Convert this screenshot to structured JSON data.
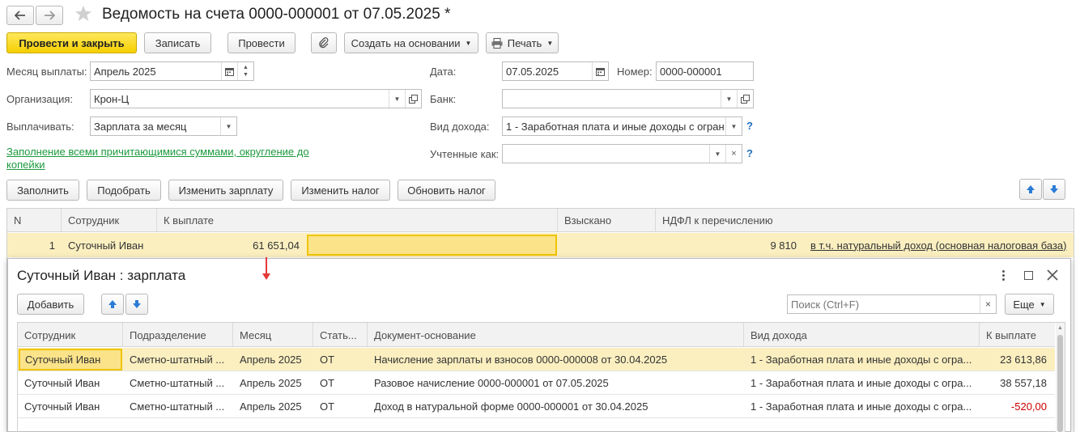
{
  "window": {
    "title": "Ведомость на счета 0000-000001 от 07.05.2025 *"
  },
  "toolbar": {
    "post_close": "Провести и закрыть",
    "save": "Записать",
    "post": "Провести",
    "create_based": "Создать на основании",
    "print": "Печать"
  },
  "form": {
    "month_label": "Месяц выплаты:",
    "month_value": "Апрель 2025",
    "org_label": "Организация:",
    "org_value": "Крон-Ц",
    "pay_label": "Выплачивать:",
    "pay_value": "Зарплата за месяц",
    "fill_link": "Заполнение всеми причитающимися суммами, округление до копейки",
    "date_label": "Дата:",
    "date_value": "07.05.2025",
    "number_label": "Номер:",
    "number_value": "0000-000001",
    "bank_label": "Банк:",
    "bank_value": "",
    "income_label": "Вид дохода:",
    "income_value": "1 - Заработная плата и иные доходы с огран",
    "accounted_label": "Учтенные как:",
    "accounted_value": "",
    "help": "?"
  },
  "actions": {
    "fill": "Заполнить",
    "pick": "Подобрать",
    "change_salary": "Изменить зарплату",
    "change_tax": "Изменить налог",
    "update_tax": "Обновить налог"
  },
  "main_table": {
    "headers": [
      "N",
      "Сотрудник",
      "К выплате",
      "Взыскано",
      "НДФЛ к перечислению"
    ],
    "rows": [
      {
        "n": "1",
        "employee": "Суточный Иван",
        "to_pay": "61 651,04",
        "collected": "",
        "ndfl": "9 810",
        "ndfl_link": "в т.ч. натуральный доход (основная налоговая база)"
      }
    ]
  },
  "popup": {
    "title": "Суточный Иван : зарплата",
    "add": "Добавить",
    "search_placeholder": "Поиск (Ctrl+F)",
    "more": "Еще",
    "headers": [
      "Сотрудник",
      "Подразделение",
      "Месяц",
      "Стать...",
      "Документ-основание",
      "Вид дохода",
      "К выплате"
    ],
    "rows": [
      {
        "employee": "Суточный Иван",
        "division": "Сметно-штатный ...",
        "month": "Апрель 2025",
        "item": "ОТ",
        "doc": "Начисление зарплаты и взносов 0000-000008 от 30.04.2025",
        "income": "1 - Заработная плата и иные доходы с огра...",
        "amount": "23 613,86"
      },
      {
        "employee": "Суточный Иван",
        "division": "Сметно-штатный ...",
        "month": "Апрель 2025",
        "item": "ОТ",
        "doc": "Разовое начисление 0000-000001 от 07.05.2025",
        "income": "1 - Заработная плата и иные доходы с огра...",
        "amount": "38 557,18"
      },
      {
        "employee": "Суточный Иван",
        "division": "Сметно-штатный ...",
        "month": "Апрель 2025",
        "item": "ОТ",
        "doc": "Доход в натуральной форме 0000-000001 от 30.04.2025",
        "income": "1 - Заработная плата и иные доходы с огра...",
        "amount": "-520,00"
      }
    ]
  },
  "colors": {
    "accent_yellow": "#f5cf00",
    "selected_row": "#fbefc0",
    "link_green": "#1c9a3e",
    "negative": "#cc0000"
  }
}
